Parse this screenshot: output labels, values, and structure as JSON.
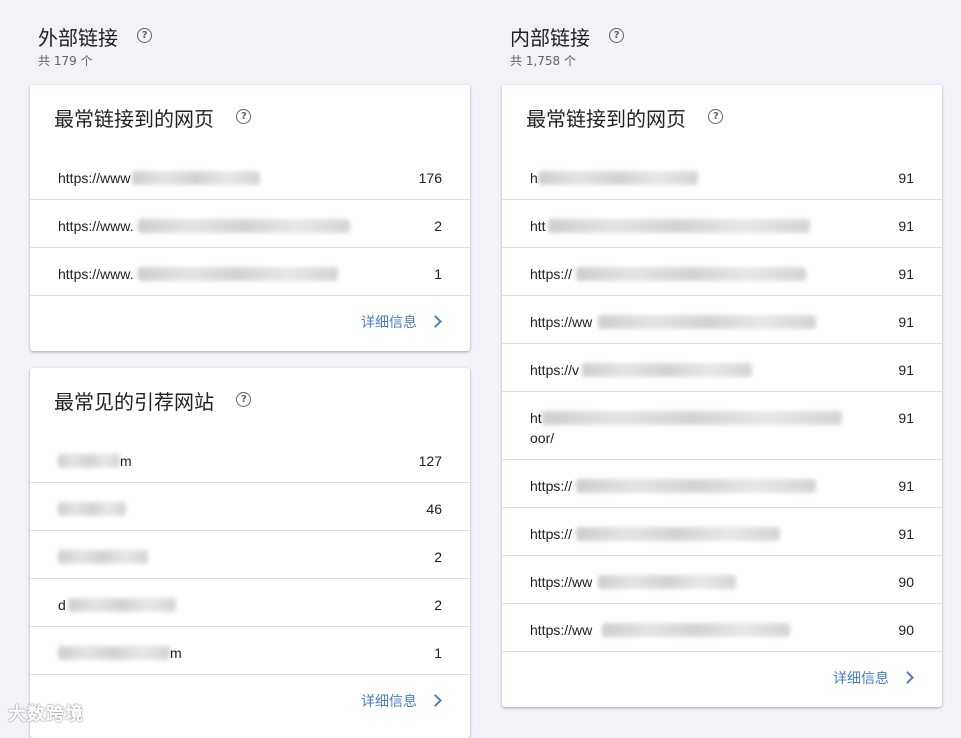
{
  "external": {
    "title": "外部链接",
    "subtitle": "共 179 个",
    "top_pages": {
      "title": "最常链接到的网页",
      "rows": [
        {
          "url": "https://www",
          "count": "176"
        },
        {
          "url": "https://www.",
          "count": "2"
        },
        {
          "url": "https://www.",
          "count": "1"
        }
      ],
      "more": "详细信息"
    },
    "top_sites": {
      "title": "最常见的引荐网站",
      "rows": [
        {
          "url": "m",
          "count": "127"
        },
        {
          "url": "",
          "count": "46"
        },
        {
          "url": "",
          "count": "2"
        },
        {
          "url": "d",
          "count": "2"
        },
        {
          "url": "m",
          "count": "1"
        }
      ],
      "more": "详细信息"
    }
  },
  "internal": {
    "title": "内部链接",
    "subtitle": "共 1,758 个",
    "top_pages": {
      "title": "最常链接到的网页",
      "rows": [
        {
          "url": "h",
          "count": "91"
        },
        {
          "url": "htt",
          "count": "91"
        },
        {
          "url": "https://",
          "count": "91"
        },
        {
          "url": "https://ww",
          "count": "91"
        },
        {
          "url": "https://v",
          "count": "91"
        },
        {
          "url": "ht",
          "url2": "oor/",
          "count": "91"
        },
        {
          "url": "https://",
          "count": "91"
        },
        {
          "url": "https://",
          "count": "91"
        },
        {
          "url": "https://ww",
          "count": "90"
        },
        {
          "url": "https://ww",
          "count": "90"
        }
      ],
      "more": "详细信息"
    }
  },
  "help_icon": "help-circle-icon",
  "more_icon": "chevron-right-icon",
  "watermark": "大数跨境",
  "colors": {
    "link": "#4a7fc1",
    "background": "#f1f3f8",
    "card": "#ffffff"
  }
}
